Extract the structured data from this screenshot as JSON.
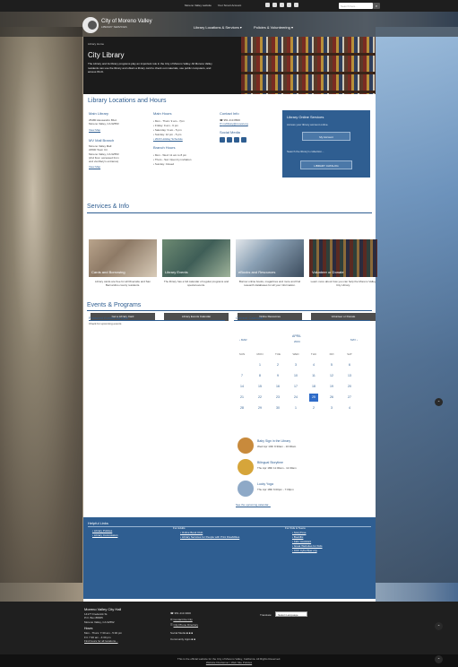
{
  "topbar": {
    "links": [
      "Moreno Valley website",
      "Your Smart Account"
    ],
    "search_placeholder": "Search here...",
    "search_icon": "search-icon"
  },
  "header": {
    "brand": "City of Moreno Valley",
    "tagline": "LIBRARY SERVICES",
    "nav": [
      "Library Locations & Services ▾",
      "Policies & Volunteering ▾"
    ]
  },
  "hero": {
    "crumb": "Library Home",
    "title": "City Library",
    "text": "The Library and its library programs play an important role in the City of Moreno Valley. All Moreno Valley residents can use the library and obtain a library card to check out materials, use public computers, and access Wi-Fi."
  },
  "locations": {
    "title": "Library Locations and Hours",
    "main_library": {
      "heading": "Main Library",
      "address": [
        "25480 Alessandro Blvd.",
        "Moreno Valley, CA 92553"
      ],
      "map_link": "View Map"
    },
    "mall_branch": {
      "heading": "MV Mall Branch",
      "address": [
        "Moreno Valley Mall",
        "22500 Town Cir.",
        "Moreno Valley, CA 92553",
        "(2nd floor, accessed from",
        "and via Macy's entrance)"
      ],
      "map_link": "View Map"
    },
    "main_hours": {
      "heading": "Main Hours",
      "items": [
        "Mon - Thurs: 9 am - 7pm",
        "Friday: 9 am - 6 pm",
        "Saturday: 9 am - 5 pm",
        "Sunday: 12 pm - 5 pm",
        "2023 Holiday Schedule"
      ]
    },
    "branch_hours": {
      "heading": "Branch Hours",
      "items": [
        "Mon - Wed: 11 am to 8 pm",
        "Thurs - Sat: Open by invitation",
        "Sunday: Closed"
      ]
    },
    "contact": {
      "heading": "Contact Info",
      "phone": "951.413.8800",
      "email": "mvlibrary@moval.org",
      "social_heading": "Social Media"
    }
  },
  "online_services": {
    "title": "Library Online Services",
    "text1": "Access your library account online.",
    "button1": "My Account",
    "text2": "Search the library's collection...",
    "button2": "LIBRARY CATALOG"
  },
  "services": {
    "title": "Services & Info",
    "cards": [
      {
        "title": "Cards and Borrowing",
        "text": "Library cards are free for all Riverside and San Bernardino county residents.",
        "button": "Get a Library Card"
      },
      {
        "title": "Library Events",
        "text": "The library has a full calendar of regular programs and special events.",
        "button": "Library Events Calendar"
      },
      {
        "title": "eBooks and Resources",
        "text": "Borrow online books, magazines and more and find research databases for all your information.",
        "button": "Online Resources"
      },
      {
        "title": "Volunteer or Donate",
        "text": "Learn more about how you can help the Moreno Valley City Library.",
        "button": "Volunteer or Donate"
      }
    ]
  },
  "events": {
    "title": "Events & Programs",
    "featured_heading": "Featured Events for April",
    "featured_text": "Check for upcoming events",
    "calendar_heading": "Current Calendar",
    "month": "APRIL",
    "year": "2024",
    "prev": "‹ MAR",
    "next": "MAY ›",
    "days": [
      "SUN",
      "MON",
      "TUE",
      "WED",
      "THU",
      "FRI",
      "SAT"
    ],
    "weeks": [
      [
        "",
        "1",
        "2",
        "3",
        "4",
        "5",
        "6"
      ],
      [
        "7",
        "8",
        "9",
        "10",
        "11",
        "12",
        "13"
      ],
      [
        "14",
        "15",
        "16",
        "17",
        "18",
        "19",
        "20"
      ],
      [
        "21",
        "22",
        "23",
        "24",
        "25",
        "26",
        "27"
      ],
      [
        "28",
        "29",
        "30",
        "1",
        "2",
        "3",
        "4"
      ]
    ],
    "today": "25",
    "list": [
      {
        "name": "Baby Sign in the Library",
        "date": "Wed Apr 10th 9:30am - 10:00am"
      },
      {
        "name": "Bilingual Storytime",
        "date": "Thu Apr 18th 11:00am - 11:30am"
      },
      {
        "name": "Lucky Yoga",
        "date": "Thu Apr 18th 6:00pm - 7:00pm"
      }
    ],
    "see_more": "See the upcoming calendar..."
  },
  "helpful_links": {
    "title": "Helpful Links",
    "col1": [
      "Library Policies",
      "Library Commission"
    ],
    "col2_heading": "For Adults",
    "col2": [
      "Online Book Club",
      "Library Services for People with Print Disabilities"
    ],
    "col3_heading": "For Kids & Teens",
    "col3": [
      "StoryTime",
      "Bookflix",
      "Kids' Assistant",
      "Great Websites for Kids",
      "CCF Cyberflyer.org"
    ]
  },
  "footer": {
    "org": "Moreno Valley City Hall",
    "address": [
      "14177 Frederick St.",
      "P.O. Box 88005",
      "Moreno Valley, CA 92552"
    ],
    "hours_heading": "Hours",
    "hours": [
      "Mon - Thurs: 7:30 am - 5:30 pm",
      "Fri: 7:30 am - 4:30 pm"
    ],
    "holidays_link": "Find hours for all locations...",
    "phone": "951.413.3000",
    "contact_link": "Contact the City",
    "directory_link": "City Phone Directory",
    "social_label": "Social Media",
    "community_label": "Community Apps",
    "translate_label": "Translate:",
    "translate_select": "Select Language"
  },
  "copyright": {
    "line1": "This is the official website for the City of Moreno Valley, California. All Rights Reserved.",
    "line2": "Website Disclaimer | Web Site Policies"
  },
  "colors": {
    "accent": "#2f5e91",
    "button_dark": "#4d4d4d",
    "today": "#2f6cc8"
  }
}
